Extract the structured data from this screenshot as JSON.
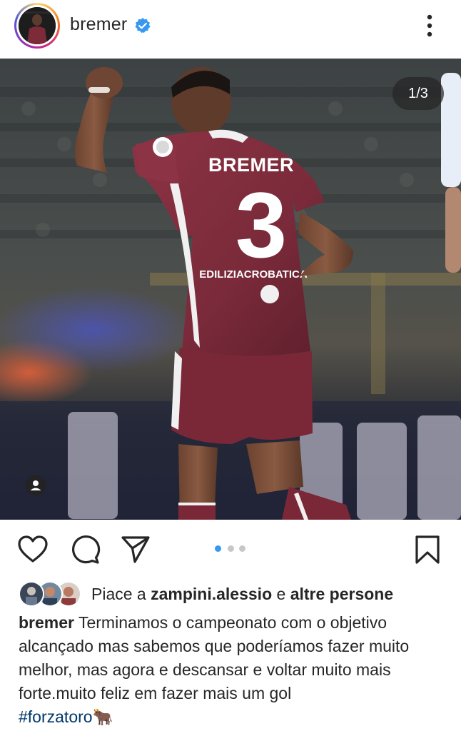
{
  "header": {
    "username": "bremer",
    "verified": true
  },
  "post": {
    "counter": "1/3",
    "jersey_name": "BREMER",
    "jersey_number": "3",
    "sponsor": "EDILIZIACROBATICA"
  },
  "carousel": {
    "total": 3,
    "active_index": 0
  },
  "likes": {
    "prefix": "Piace a",
    "user": "zampini.alessio",
    "joiner": "e",
    "suffix": "altre persone"
  },
  "caption": {
    "user": "bremer",
    "text": "Terminamos o campeonato com o objetivo alcançado mas sabemos que poderíamos fazer muito melhor, mas agora e descansar e voltar muito mais forte.muito feliz em fazer mais um gol",
    "hashtag": "#forzatoro",
    "emoji": "🐂"
  },
  "colors": {
    "verified_blue": "#3897f0",
    "dot_active": "#3897f0",
    "dot_inactive": "#c7c7c7",
    "hashtag": "#00376b",
    "jersey": "#7d2a39"
  },
  "icons": {
    "like": "heart-icon",
    "comment": "comment-icon",
    "share": "send-icon",
    "save": "bookmark-icon",
    "more": "more-vertical-icon",
    "tag": "user-tag-icon"
  }
}
